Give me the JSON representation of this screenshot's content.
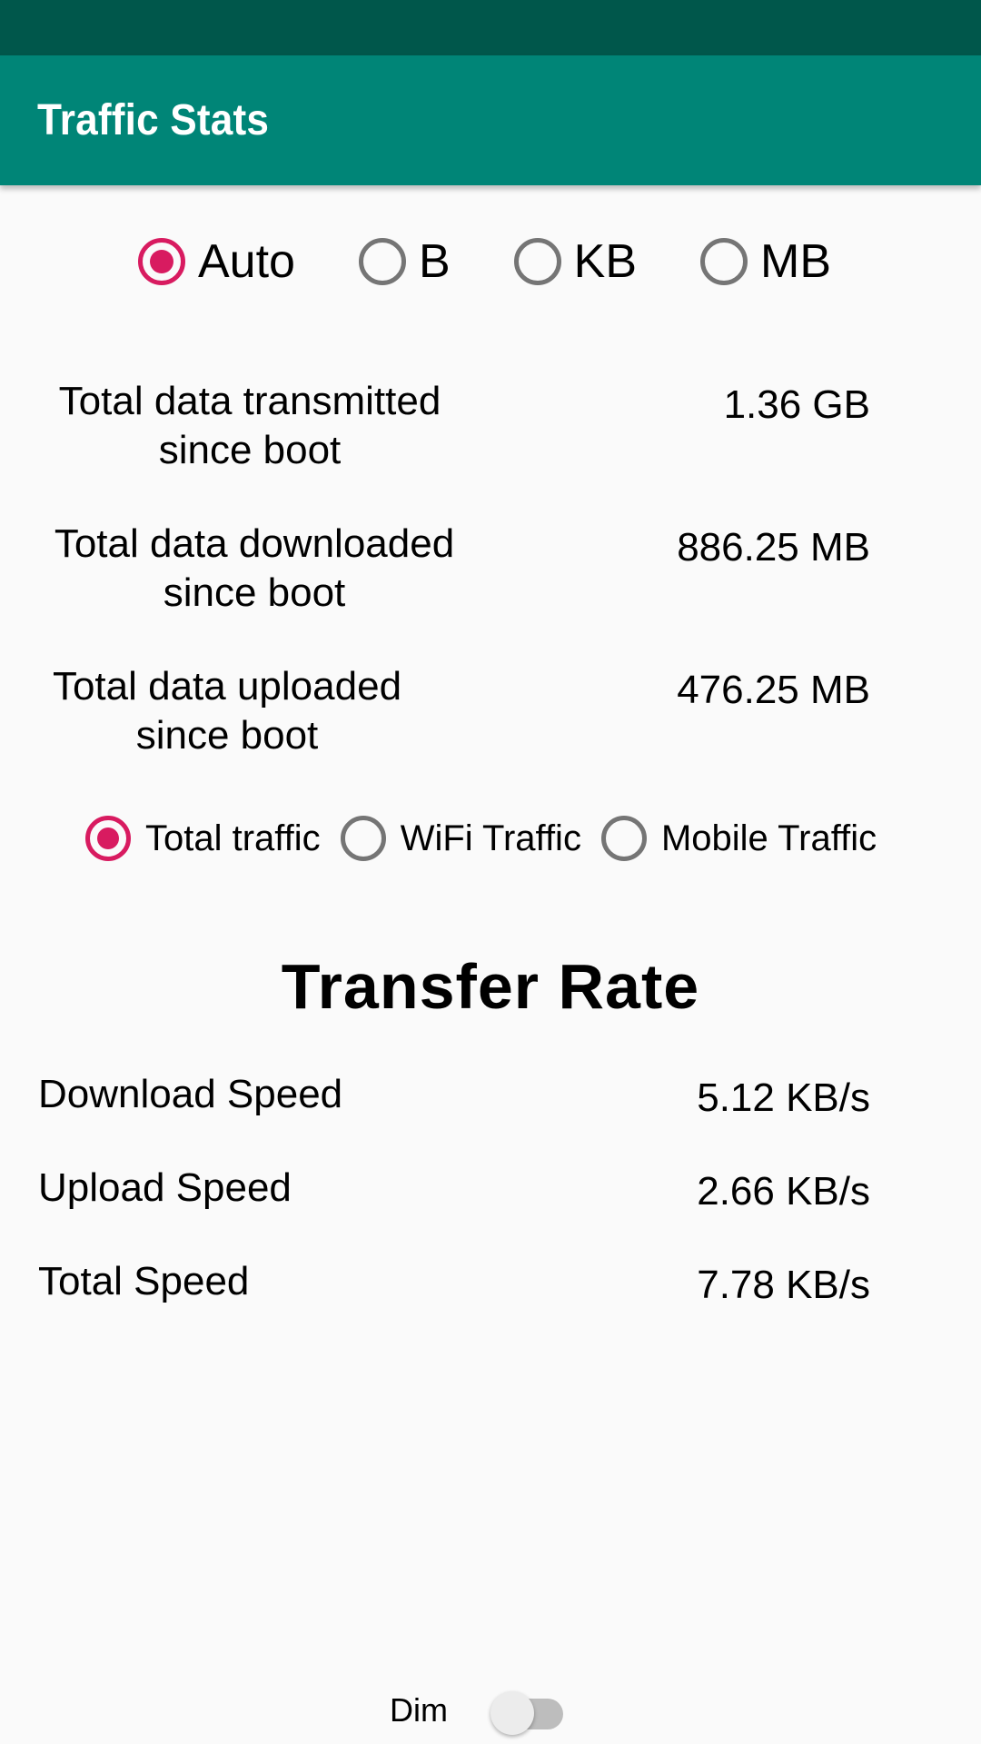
{
  "app_bar": {
    "title": "Traffic Stats"
  },
  "colors": {
    "primary": "#008577",
    "primary_dark": "#00574b",
    "accent": "#d81b60"
  },
  "unit_options": [
    {
      "label": "Auto",
      "checked": true
    },
    {
      "label": "B",
      "checked": false
    },
    {
      "label": "KB",
      "checked": false
    },
    {
      "label": "MB",
      "checked": false
    }
  ],
  "stats": [
    {
      "label_line1": "Total data transmitted",
      "label_line2": "since boot",
      "value": "1.36 GB"
    },
    {
      "label_line1": "Total data downloaded",
      "label_line2": "since boot",
      "value": "886.25 MB"
    },
    {
      "label_line1": "Total data uploaded",
      "label_line2": "since boot",
      "value": "476.25 MB"
    }
  ],
  "traffic_options": [
    {
      "label": "Total traffic",
      "checked": true
    },
    {
      "label": "WiFi Traffic",
      "checked": false
    },
    {
      "label": "Mobile Traffic",
      "checked": false
    }
  ],
  "transfer_rate": {
    "title": "Transfer Rate",
    "rows": [
      {
        "label": "Download Speed",
        "value": "5.12 KB/s"
      },
      {
        "label": "Upload Speed",
        "value": "2.66 KB/s"
      },
      {
        "label": "Total Speed",
        "value": "7.78 KB/s"
      }
    ]
  },
  "dim": {
    "label": "Dim",
    "on": false
  }
}
